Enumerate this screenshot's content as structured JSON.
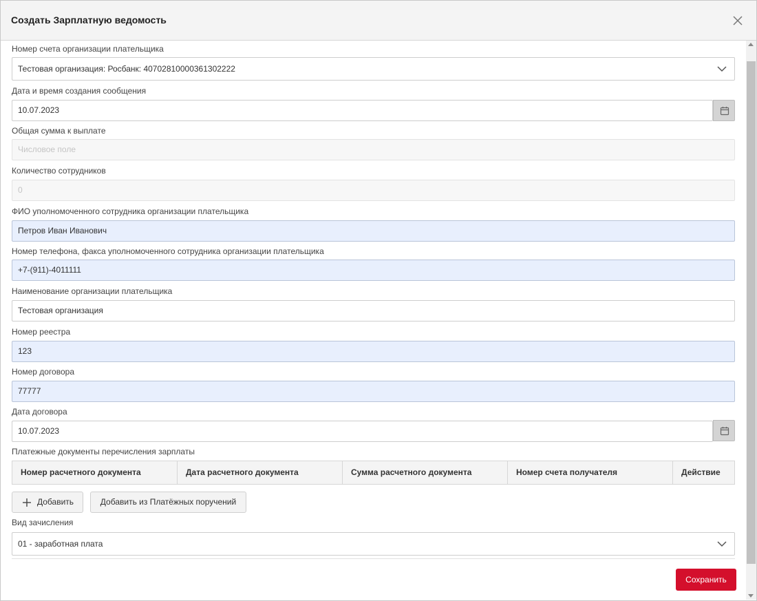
{
  "dialog": {
    "title": "Создать Зарплатную ведомость",
    "close_icon": "close-icon"
  },
  "form": {
    "payer_account": {
      "label": "Номер счета организации плательщика",
      "value": "Тестовая организация: Росбанк: 40702810000361302222"
    },
    "creation_datetime": {
      "label": "Дата и время создания сообщения",
      "value": "10.07.2023"
    },
    "total_amount": {
      "label": "Общая сумма к выплате",
      "placeholder": "Числовое поле"
    },
    "employee_count": {
      "label": "Количество сотрудников",
      "value": "0"
    },
    "authorized_person": {
      "label": "ФИО уполномоченного сотрудника организации плательщика",
      "value": "Петров Иван Иванович"
    },
    "phone": {
      "label": "Номер телефона, факса уполномоченного сотрудника организации плательщика",
      "value": "+7-(911)-4011111"
    },
    "org_name": {
      "label": "Наименование организации плательщика",
      "value": "Тестовая организация"
    },
    "registry_number": {
      "label": "Номер реестра",
      "value": "123"
    },
    "contract_number": {
      "label": "Номер договора",
      "value": "77777"
    },
    "contract_date": {
      "label": "Дата договора",
      "value": "10.07.2023"
    },
    "payment_docs": {
      "label": "Платежные документы перечисления зарплаты",
      "columns": [
        "Номер расчетного документа",
        "Дата расчетного документа",
        "Сумма расчетного документа",
        "Номер счета получателя",
        "Действие"
      ],
      "add_label": "Добавить",
      "add_from_label": "Добавить из Платёжных поручений"
    },
    "accrual_type": {
      "label": "Вид зачисления",
      "value": "01 - заработная плата"
    }
  },
  "footer": {
    "save_label": "Сохранить"
  },
  "colors": {
    "accent": "#d40f2c",
    "filled_field_bg": "#e8effd",
    "header_bg": "#f4f4f4"
  }
}
